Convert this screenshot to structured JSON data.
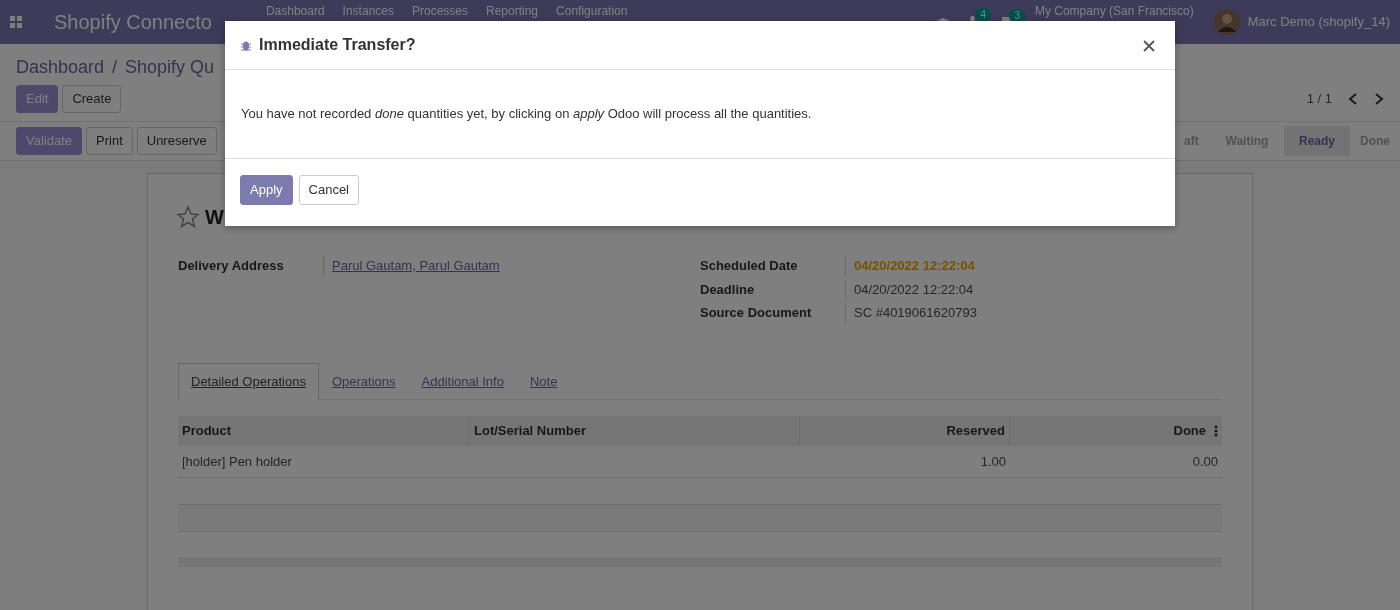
{
  "navbar": {
    "brand": "Shopify Connecto",
    "menu": [
      "Dashboard",
      "Instances",
      "Processes",
      "Reporting",
      "Configuration"
    ],
    "activity_count": "4",
    "message_count": "3",
    "company": "My Company (San Francisco)",
    "user": "Marc Demo (shopify_14)"
  },
  "breadcrumb": {
    "items": [
      "Dashboard",
      "Shopify Qu"
    ],
    "separator": "/"
  },
  "main_buttons": [
    {
      "label": "Edit",
      "primary": true
    },
    {
      "label": "Create",
      "primary": false
    }
  ],
  "pager": "1 / 1",
  "action_buttons": [
    {
      "label": "Validate",
      "primary": true
    },
    {
      "label": "Print",
      "primary": false
    },
    {
      "label": "Unreserve",
      "primary": false
    }
  ],
  "stages": [
    {
      "label": "aft",
      "selected": false
    },
    {
      "label": "Waiting",
      "selected": false
    },
    {
      "label": "Ready",
      "selected": true
    },
    {
      "label": "Done",
      "selected": false
    }
  ],
  "record": {
    "starred": false,
    "title": "W",
    "left_fields": [
      {
        "label": "Delivery Address",
        "value": "Parul Gautam, Parul Gautam",
        "kind": "link"
      }
    ],
    "right_fields": [
      {
        "label": "Scheduled Date",
        "value": "04/20/2022 12:22:04",
        "kind": "warning"
      },
      {
        "label": "Deadline",
        "value": "04/20/2022 12:22:04",
        "kind": "plain"
      },
      {
        "label": "Source Document",
        "value": "SC #4019061620793",
        "kind": "plain"
      }
    ]
  },
  "tabs": [
    {
      "label": "Detailed Operations",
      "selected": true
    },
    {
      "label": "Operations",
      "selected": false
    },
    {
      "label": "Additional Info",
      "selected": false
    },
    {
      "label": "Note",
      "selected": false
    }
  ],
  "table": {
    "columns": [
      {
        "label": "Product",
        "kind": "text"
      },
      {
        "label": "Lot/Serial Number",
        "kind": "text"
      },
      {
        "label": "Reserved",
        "kind": "number"
      },
      {
        "label": "Done",
        "kind": "number"
      }
    ],
    "rows": [
      {
        "cells": [
          "[holder] Pen holder",
          null,
          "1.00",
          "0.00"
        ]
      }
    ]
  },
  "dialog": {
    "title": "Immediate Transfer?",
    "message": "You have not recorded *done* quantities yet, by clicking on *apply* Odoo will process all the quantities.",
    "buttons": [
      {
        "label": "Apply",
        "primary": true
      },
      {
        "label": "Cancel",
        "primary": false
      }
    ]
  }
}
